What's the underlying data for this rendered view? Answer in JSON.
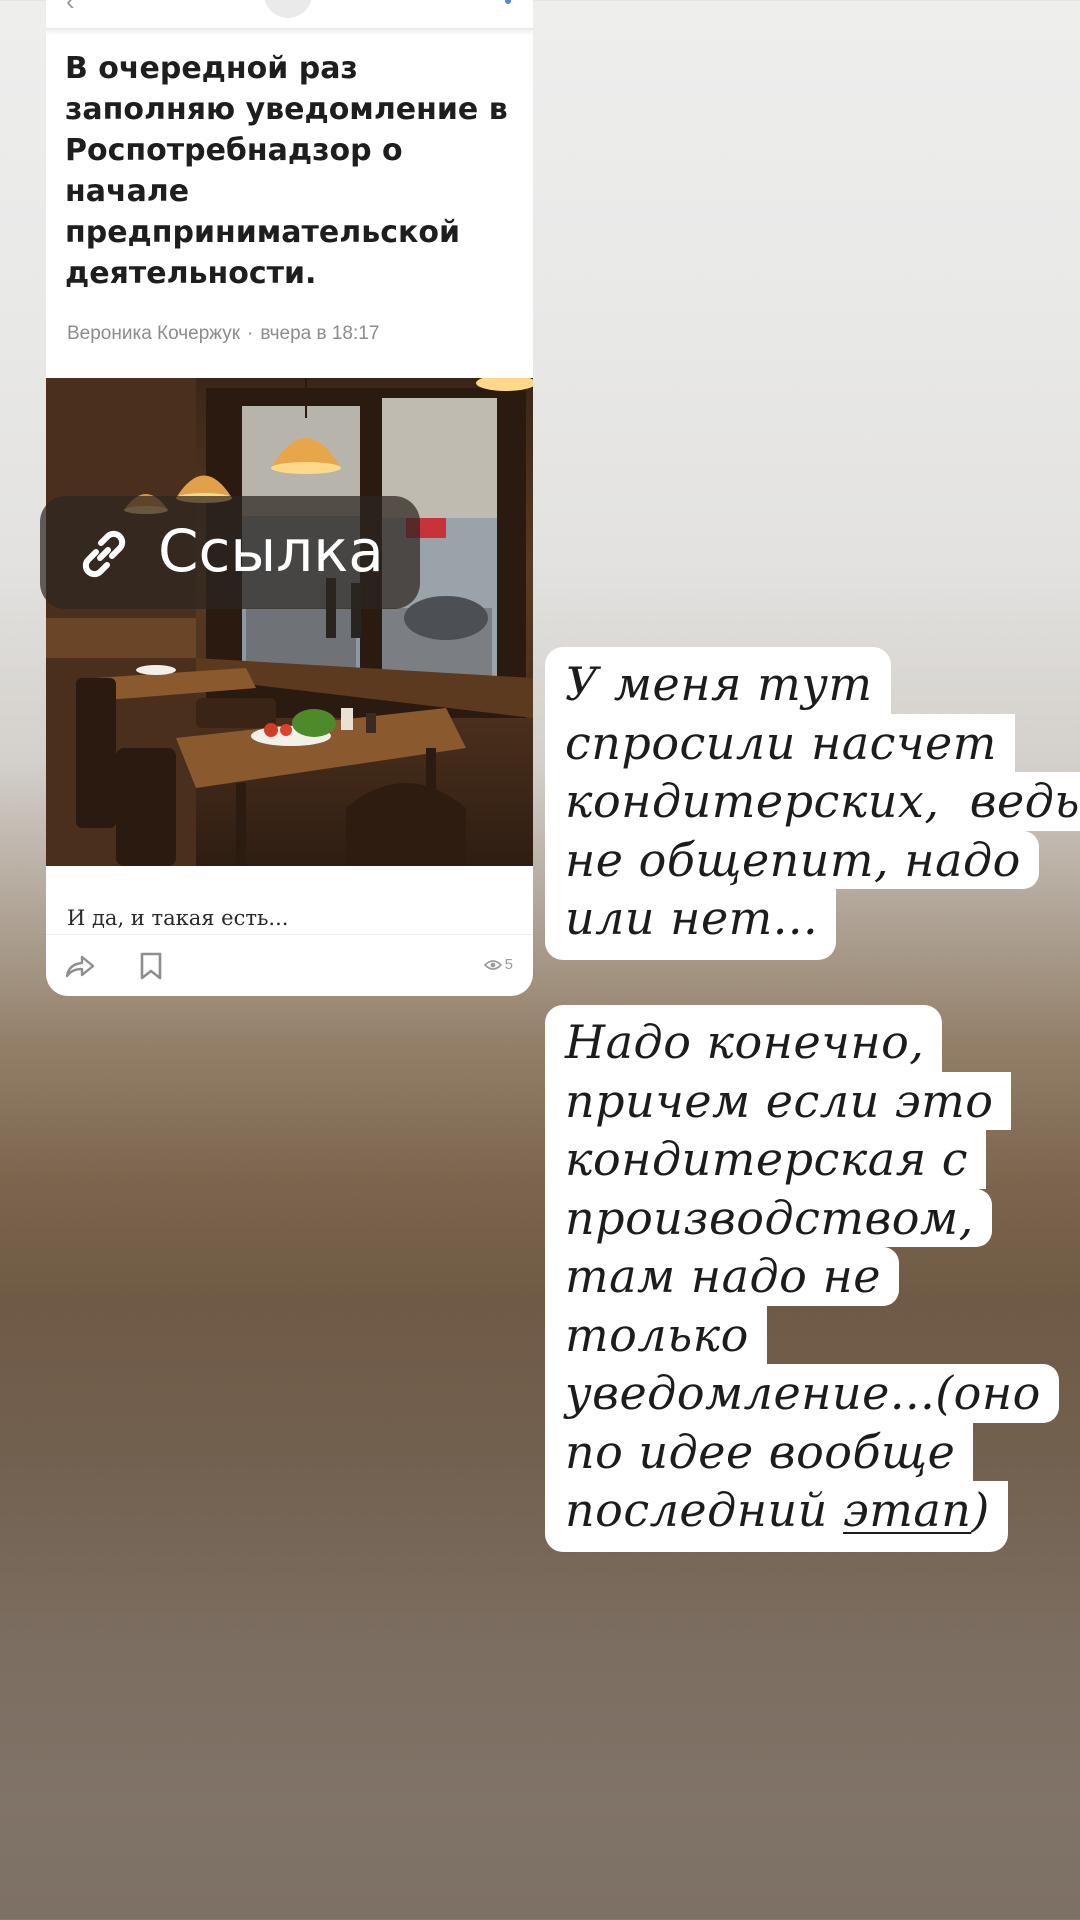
{
  "post": {
    "title": "В очередной раз заполняю уведомление в Роспотребнадзор о начале предпринимательской деятельности.",
    "author": "Вероника Кочержук",
    "separator": "·",
    "time": "вчера в 18:17",
    "caption": "И да, и такая есть...",
    "views": "5"
  },
  "sticker": {
    "label": "Ссылка",
    "icon": "link-icon"
  },
  "notes": {
    "first": [
      "У меня тут",
      "спросили насчет",
      "кондитерских,  ведь",
      "не общепит, надо",
      "или нет..."
    ],
    "second": [
      "Надо конечно,",
      "причем если это",
      "кондитерская с",
      "производством,",
      "там надо не",
      "только",
      "уведомление...(оно",
      "по идее вообще",
      "последний "
    ],
    "second_underlined": "этап",
    "second_tail": ")"
  },
  "icons": {
    "share": "share-arrow-icon",
    "bookmark": "bookmark-icon",
    "views": "eye-icon"
  }
}
